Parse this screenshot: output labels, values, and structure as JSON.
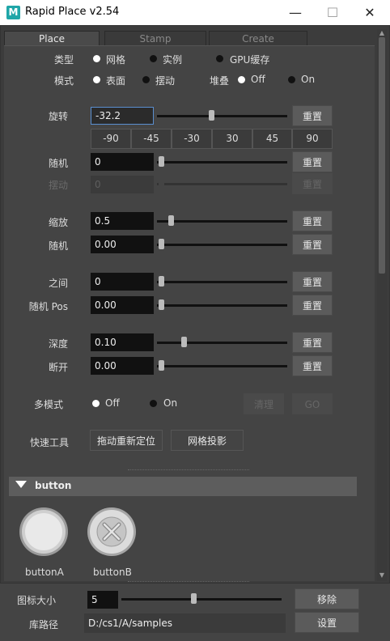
{
  "window": {
    "title": "Rapid Place v2.54",
    "icon_letter": "M",
    "accent": "#1fa6a8",
    "controls": {
      "minimize": "—",
      "maximize": "☐",
      "close": "✕"
    }
  },
  "tabs": [
    {
      "label": "Place",
      "active": true
    },
    {
      "label": "Stamp",
      "active": false
    },
    {
      "label": "Create",
      "active": false
    }
  ],
  "place": {
    "type": {
      "label": "类型",
      "options": [
        "网格",
        "实例",
        "GPU缓存"
      ],
      "selected": "网格"
    },
    "mode": {
      "label": "模式",
      "options": [
        "表面",
        "摆动"
      ],
      "selected": "表面"
    },
    "stack": {
      "label": "堆叠",
      "options": [
        "Off",
        "On"
      ],
      "selected": "Off"
    },
    "rotate": {
      "label": "旋转",
      "value": "-32.2",
      "reset": "重置"
    },
    "presets": [
      "-90",
      "-45",
      "-30",
      "30",
      "45",
      "90"
    ],
    "random": {
      "label": "随机",
      "value": "0",
      "reset": "重置"
    },
    "wobble": {
      "label": "摆动",
      "value": "0",
      "reset": "重置"
    },
    "scale": {
      "label": "缩放",
      "value": "0.5",
      "reset": "重置"
    },
    "scale_random": {
      "label": "随机",
      "value": "0.00",
      "reset": "重置"
    },
    "between": {
      "label": "之间",
      "value": "0",
      "reset": "重置"
    },
    "random_pos": {
      "label": "随机 Pos",
      "value": "0.00",
      "reset": "重置"
    },
    "depth": {
      "label": "深度",
      "value": "0.10",
      "reset": "重置"
    },
    "break": {
      "label": "断开",
      "value": "0.00",
      "reset": "重置"
    },
    "multi_mode": {
      "label": "多模式",
      "options": [
        "Off",
        "On"
      ],
      "selected": "Off",
      "clear": "清理",
      "go": "GO"
    },
    "quick_tools": {
      "label": "快速工具",
      "buttons": [
        "拖动重新定位",
        "网格投影"
      ]
    }
  },
  "section": {
    "title": "button",
    "items": [
      {
        "label": "buttonA",
        "icon": "circle-button-icon"
      },
      {
        "label": "buttonB",
        "icon": "cross-button-icon"
      }
    ]
  },
  "bottom": {
    "icon_size": {
      "label": "图标大小",
      "value": "5",
      "button": "移除"
    },
    "library_path": {
      "label": "库路径",
      "value": "D:/cs1/A/samples",
      "button": "设置"
    }
  }
}
